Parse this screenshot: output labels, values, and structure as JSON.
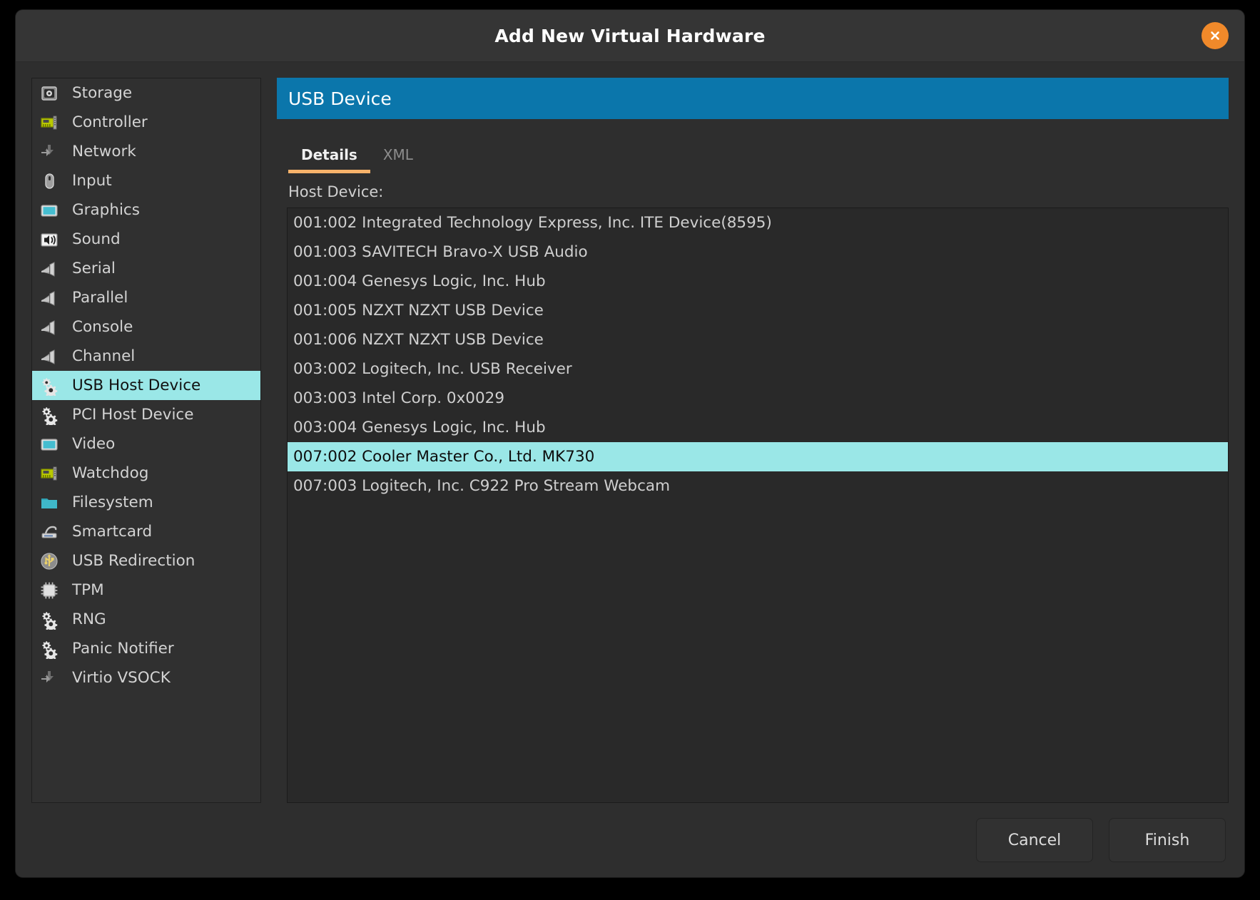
{
  "window": {
    "title": "Add New Virtual Hardware",
    "close_icon": "close-icon"
  },
  "sidebar": {
    "items": [
      {
        "label": "Storage",
        "icon": "storage-disk-icon",
        "selected": false
      },
      {
        "label": "Controller",
        "icon": "expansion-card-icon",
        "selected": false
      },
      {
        "label": "Network",
        "icon": "network-arrows-icon",
        "selected": false
      },
      {
        "label": "Input",
        "icon": "mouse-icon",
        "selected": false
      },
      {
        "label": "Graphics",
        "icon": "display-icon",
        "selected": false
      },
      {
        "label": "Sound",
        "icon": "speaker-icon",
        "selected": false
      },
      {
        "label": "Serial",
        "icon": "serial-port-icon",
        "selected": false
      },
      {
        "label": "Parallel",
        "icon": "serial-port-icon",
        "selected": false
      },
      {
        "label": "Console",
        "icon": "serial-port-icon",
        "selected": false
      },
      {
        "label": "Channel",
        "icon": "serial-port-icon",
        "selected": false
      },
      {
        "label": "USB Host Device",
        "icon": "gears-icon",
        "selected": true
      },
      {
        "label": "PCI Host Device",
        "icon": "gears-icon",
        "selected": false
      },
      {
        "label": "Video",
        "icon": "display-icon",
        "selected": false
      },
      {
        "label": "Watchdog",
        "icon": "expansion-card-icon",
        "selected": false
      },
      {
        "label": "Filesystem",
        "icon": "folder-icon",
        "selected": false
      },
      {
        "label": "Smartcard",
        "icon": "smartcard-icon",
        "selected": false
      },
      {
        "label": "USB Redirection",
        "icon": "usb-icon",
        "selected": false
      },
      {
        "label": "TPM",
        "icon": "chip-icon",
        "selected": false
      },
      {
        "label": "RNG",
        "icon": "gears-icon",
        "selected": false
      },
      {
        "label": "Panic Notifier",
        "icon": "gears-icon",
        "selected": false
      },
      {
        "label": "Virtio VSOCK",
        "icon": "network-arrows-icon",
        "selected": false
      }
    ]
  },
  "main": {
    "pane_title": "USB Device",
    "tabs": [
      {
        "label": "Details",
        "active": true
      },
      {
        "label": "XML",
        "active": false
      }
    ],
    "host_device_label": "Host Device:",
    "devices": [
      {
        "text": "001:002 Integrated Technology Express, Inc. ITE Device(8595)",
        "selected": false
      },
      {
        "text": "001:003 SAVITECH Bravo-X USB Audio",
        "selected": false
      },
      {
        "text": "001:004 Genesys Logic, Inc. Hub",
        "selected": false
      },
      {
        "text": "001:005 NZXT NZXT USB Device",
        "selected": false
      },
      {
        "text": "001:006 NZXT NZXT USB Device",
        "selected": false
      },
      {
        "text": "003:002 Logitech, Inc. USB Receiver",
        "selected": false
      },
      {
        "text": "003:003 Intel Corp. 0x0029",
        "selected": false
      },
      {
        "text": "003:004 Genesys Logic, Inc. Hub",
        "selected": false
      },
      {
        "text": "007:002 Cooler Master Co., Ltd. MK730",
        "selected": true
      },
      {
        "text": "007:003 Logitech, Inc. C922 Pro Stream Webcam",
        "selected": false
      }
    ]
  },
  "footer": {
    "cancel_label": "Cancel",
    "finish_label": "Finish"
  },
  "colors": {
    "accent_header": "#0b76ab",
    "selection": "#9ae7e7",
    "tab_underline": "#f7b26a",
    "close_button": "#f0892a",
    "window_bg": "#353535",
    "panel_bg": "#2e2e2e"
  }
}
